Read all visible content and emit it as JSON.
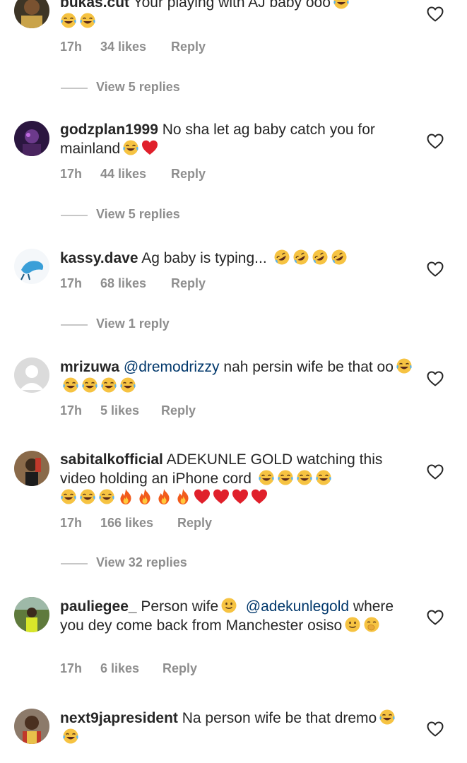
{
  "comments": [
    {
      "username": "bukas.cut",
      "text": "Your playing with AJ baby ooo",
      "emojis": [
        "laughing-tears-emoji",
        "laughing-tears-emoji",
        "laughing-tears-emoji"
      ],
      "time": "17h",
      "likes": "34 likes",
      "reply": "Reply",
      "view_replies": "View 5 replies"
    },
    {
      "username": "godzplan1999",
      "text": "No sha let ag baby catch you for mainland",
      "emojis": [
        "laughing-tears-emoji",
        "red-heart-emoji"
      ],
      "time": "17h",
      "likes": "44 likes",
      "reply": "Reply",
      "view_replies": "View 5 replies"
    },
    {
      "username": "kassy.dave",
      "text": "Ag baby is typing...",
      "emojis": [
        "rolling-laughing-emoji",
        "rolling-laughing-emoji",
        "rolling-laughing-emoji",
        "rolling-laughing-emoji"
      ],
      "time": "17h",
      "likes": "68 likes",
      "reply": "Reply",
      "view_replies": "View 1 reply"
    },
    {
      "username": "mrizuwa",
      "mention": "@dremodrizzy",
      "text": "nah persin wife be that oo",
      "emojis": [
        "laughing-tears-emoji",
        "laughing-tears-emoji",
        "laughing-tears-emoji",
        "laughing-tears-emoji",
        "laughing-tears-emoji"
      ],
      "time": "17h",
      "likes": "5 likes",
      "reply": "Reply"
    },
    {
      "username": "sabitalkofficial",
      "text": "ADEKUNLE GOLD watching this video holding an iPhone cord",
      "emojis": [
        "laughing-tears-emoji",
        "laughing-tears-emoji",
        "laughing-tears-emoji",
        "laughing-tears-emoji",
        "laughing-tears-emoji",
        "laughing-tears-emoji",
        "laughing-tears-emoji",
        "fire-emoji",
        "fire-emoji",
        "fire-emoji",
        "fire-emoji",
        "red-heart-emoji",
        "red-heart-emoji",
        "red-heart-emoji",
        "red-heart-emoji"
      ],
      "time": "17h",
      "likes": "166 likes",
      "reply": "Reply",
      "view_replies": "View 32 replies"
    },
    {
      "username": "pauliegee_",
      "text_before": "Person wife",
      "mention": "@adekunlegold",
      "text_after": "where you dey come back from Manchester osiso",
      "emojis": [
        "slight-smile-emoji",
        "hand-over-mouth-emoji"
      ],
      "time": "17h",
      "likes": "6 likes",
      "reply": "Reply"
    },
    {
      "username": "next9japresident",
      "text": "Na person wife be that dremo",
      "emojis": [
        "laughing-tears-emoji",
        "laughing-tears-emoji"
      ]
    }
  ],
  "icons": {
    "like": "heart-outline-icon"
  },
  "colors": {
    "text": "#262626",
    "meta": "#8e8e8e",
    "mention": "#00376b",
    "heart": "#262626"
  }
}
